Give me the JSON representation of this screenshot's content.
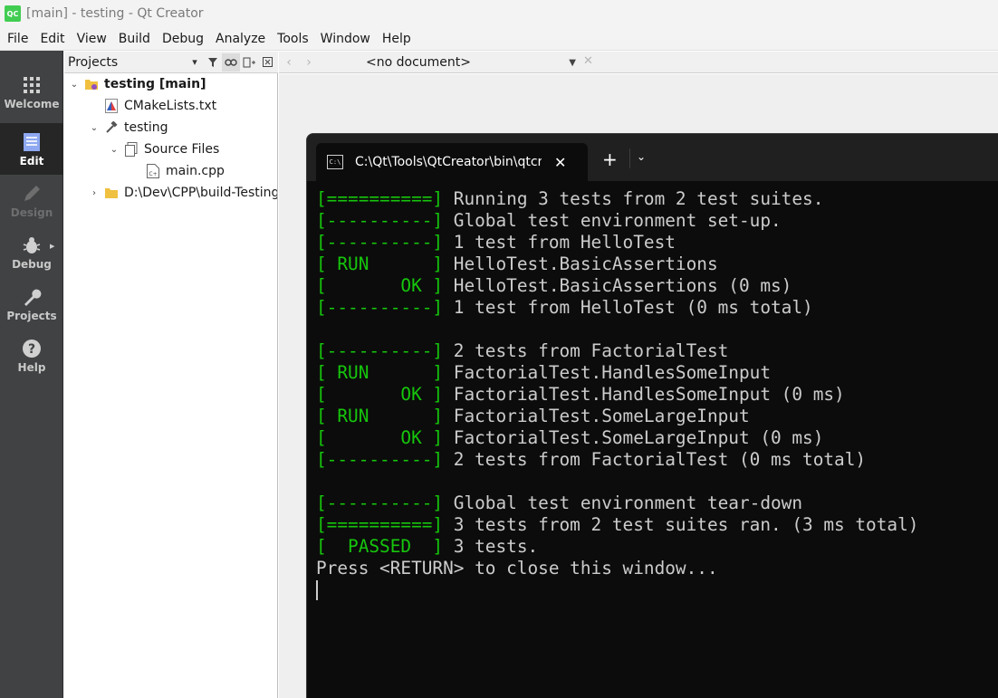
{
  "window": {
    "app_icon_text": "QC",
    "title": "[main] - testing - Qt Creator"
  },
  "menu": [
    "File",
    "Edit",
    "View",
    "Build",
    "Debug",
    "Analyze",
    "Tools",
    "Window",
    "Help"
  ],
  "modes": [
    {
      "label": "Welcome",
      "icon": "grid-icon",
      "state": "normal"
    },
    {
      "label": "Edit",
      "icon": "document-icon",
      "state": "active"
    },
    {
      "label": "Design",
      "icon": "pencil-icon",
      "state": "disabled"
    },
    {
      "label": "Debug",
      "icon": "bug-icon",
      "state": "normal"
    },
    {
      "label": "Projects",
      "icon": "wrench-icon",
      "state": "normal"
    },
    {
      "label": "Help",
      "icon": "question-icon",
      "state": "normal"
    }
  ],
  "projects_panel": {
    "combo_label": "Projects",
    "tree": [
      {
        "label": "testing [main]",
        "icon": "project-folder-icon",
        "expanded": true,
        "bold": true
      },
      {
        "label": "CMakeLists.txt",
        "icon": "cmake-icon"
      },
      {
        "label": "testing",
        "icon": "hammer-icon",
        "expanded": true
      },
      {
        "label": "Source Files",
        "icon": "source-files-icon",
        "expanded": true
      },
      {
        "label": "main.cpp",
        "icon": "cpp-file-icon"
      },
      {
        "label": "D:\\Dev\\CPP\\build-Testing",
        "icon": "folder-icon",
        "expanded": false
      }
    ]
  },
  "editor": {
    "document_combo": "<no document>"
  },
  "terminal": {
    "tab_title": "C:\\Qt\\Tools\\QtCreator\\bin\\qtcreator_process_stub.exe",
    "colors": {
      "background": "#0c0c0c",
      "text": "#cccccc",
      "tag": "#16c60c"
    },
    "lines": [
      {
        "tag": "[==========]",
        "text": " Running 3 tests from 2 test suites."
      },
      {
        "tag": "[----------]",
        "text": " Global test environment set-up."
      },
      {
        "tag": "[----------]",
        "text": " 1 test from HelloTest"
      },
      {
        "tag": "[ RUN      ]",
        "text": " HelloTest.BasicAssertions"
      },
      {
        "tag": "[       OK ]",
        "text": " HelloTest.BasicAssertions (0 ms)"
      },
      {
        "tag": "[----------]",
        "text": " 1 test from HelloTest (0 ms total)"
      },
      {
        "tag": "",
        "text": ""
      },
      {
        "tag": "[----------]",
        "text": " 2 tests from FactorialTest"
      },
      {
        "tag": "[ RUN      ]",
        "text": " FactorialTest.HandlesSomeInput"
      },
      {
        "tag": "[       OK ]",
        "text": " FactorialTest.HandlesSomeInput (0 ms)"
      },
      {
        "tag": "[ RUN      ]",
        "text": " FactorialTest.SomeLargeInput"
      },
      {
        "tag": "[       OK ]",
        "text": " FactorialTest.SomeLargeInput (0 ms)"
      },
      {
        "tag": "[----------]",
        "text": " 2 tests from FactorialTest (0 ms total)"
      },
      {
        "tag": "",
        "text": ""
      },
      {
        "tag": "[----------]",
        "text": " Global test environment tear-down"
      },
      {
        "tag": "[==========]",
        "text": " 3 tests from 2 test suites ran. (3 ms total)"
      },
      {
        "tag": "[  PASSED  ]",
        "text": " 3 tests."
      },
      {
        "tag": "",
        "text": "Press <RETURN> to close this window..."
      }
    ]
  }
}
